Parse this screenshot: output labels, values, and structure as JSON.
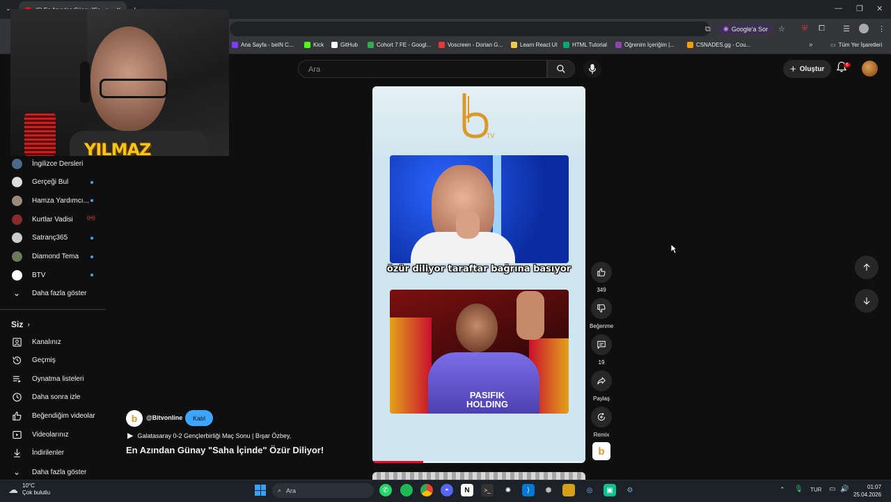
{
  "browser": {
    "tab_title": "(6) En Azından Günay \"Saha",
    "google_ask": "Google'a Sor",
    "bookmarks": [
      {
        "label": "Ana Sayfa - beIN C...",
        "color": "#7a3cff"
      },
      {
        "label": "Kick",
        "color": "#53fc18"
      },
      {
        "label": "GitHub",
        "color": "#ffffff"
      },
      {
        "label": "Cohort 7 FE - Googl...",
        "color": "#34a853"
      },
      {
        "label": "Voscreen - Dorian G...",
        "color": "#e53935"
      },
      {
        "label": "Learn React UI",
        "color": "#f2c94c"
      },
      {
        "label": "HTML Tutorial",
        "color": "#04aa6d"
      },
      {
        "label": "Öğrenim İçeriğim |...",
        "color": "#8e44ad"
      },
      {
        "label": "CSNADES.gg - Cou...",
        "color": "#f39c12"
      }
    ],
    "all_bookmarks": "Tüm Yer İşaretleri"
  },
  "header": {
    "search_placeholder": "Ara",
    "create_label": "Oluştur",
    "notification_count": "6"
  },
  "webcam": {
    "overlay_text": "YILMAZ"
  },
  "sidebar": {
    "subscriptions": [
      {
        "label": "İngilizce Dersleri",
        "avatar_color": "#4a6a8a",
        "indicator": "none"
      },
      {
        "label": "Gerçeği Bul",
        "avatar_color": "#dddddd",
        "indicator": "dot"
      },
      {
        "label": "Hamza Yardımcı...",
        "avatar_color": "#9a8a7a",
        "indicator": "dot"
      },
      {
        "label": "Kurtlar Vadisi",
        "avatar_color": "#8a2a2a",
        "indicator": "live"
      },
      {
        "label": "Satranç365",
        "avatar_color": "#cccccc",
        "indicator": "dot"
      },
      {
        "label": "Diamond Tema",
        "avatar_color": "#6a7a5a",
        "indicator": "dot"
      },
      {
        "label": "BTV",
        "avatar_color": "#ffffff",
        "indicator": "dot"
      }
    ],
    "show_more_1": "Daha fazla göster",
    "you_heading": "Siz",
    "you_items": [
      {
        "label": "Kanalınız",
        "icon": "channel-icon"
      },
      {
        "label": "Geçmiş",
        "icon": "history-icon"
      },
      {
        "label": "Oynatma listeleri",
        "icon": "playlists-icon"
      },
      {
        "label": "Daha sonra izle",
        "icon": "clock-icon"
      },
      {
        "label": "Beğendiğim videolar",
        "icon": "thumbs-up-icon"
      },
      {
        "label": "Videolarınız",
        "icon": "video-icon"
      },
      {
        "label": "İndirilenler",
        "icon": "download-icon"
      }
    ],
    "show_more_2": "Daha fazla göster"
  },
  "short": {
    "subtitle": "özür diliyor taraftar bağrına basıyor",
    "clip2_text": "PASIFIK HOLDING",
    "progress": 0.24,
    "channel_handle": "@Bitvonline",
    "join_label": "Katıl",
    "playlist_title": "Galatasaray 0-2 Gençlerbirliği Maç Sonu | Bışar Özbey,",
    "title": "En Azından Günay \"Saha İçinde\" Özür Diliyor!"
  },
  "actions": {
    "likes": "349",
    "dislike_label": "Beğenme",
    "comments": "19",
    "share_label": "Paylaş",
    "remix_label": "Remix"
  },
  "taskbar": {
    "search_placeholder": "Ara",
    "temperature": "10°C",
    "weather": "Çok bulutlu",
    "language": "TUR",
    "time": "01:07",
    "date": "25.04.2026"
  }
}
